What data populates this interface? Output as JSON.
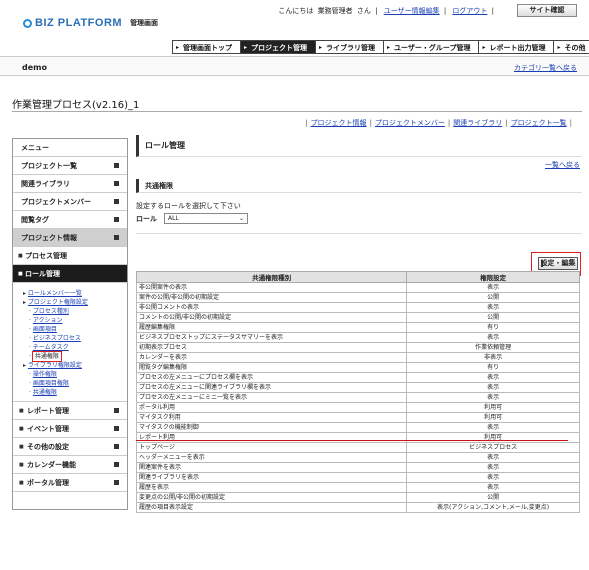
{
  "header": {
    "brand": "BIZ PLATFORM",
    "subtitle": "管理画面",
    "greeting_prefix": "こんにちは",
    "user_name": "業務管理者",
    "greeting_suffix": "さん",
    "user_info_link": "ユーザー情報編集",
    "logout_link": "ログアウト",
    "sitemap_button": "サイト確認"
  },
  "nav": {
    "tabs": [
      "管理画面トップ",
      "プロジェクト管理",
      "ライブラリ管理",
      "ユーザー・グループ管理",
      "レポート出力管理",
      "その他"
    ],
    "active_index": 1
  },
  "demobar": {
    "name": "demo",
    "category_link": "カテゴリ一覧へ戻る"
  },
  "page_title": "作業管理プロセス(v2.16)_1",
  "sublinks": [
    "プロジェクト情報",
    "プロジェクトメンバー",
    "関連ライブラリ",
    "プロジェクト一覧"
  ],
  "sidebar": {
    "menu_label": "メニュー",
    "items": [
      "プロジェクト一覧",
      "関連ライブラリ",
      "プロジェクトメンバー",
      "閲覧タグ",
      "プロジェクト情報"
    ],
    "process_mgmt": "プロセス管理",
    "role_mgmt": "ロール管理",
    "tree": {
      "role_member_list": "ロールメンバー一覧",
      "project_perm": "プロジェクト権限設定",
      "project_perm_children": [
        "プロセス種別",
        "アクション",
        "画面項目",
        "ビジネスプロセス",
        "チームタスク",
        "共通権限"
      ],
      "library_perm": "ライブラリ権限設定",
      "library_perm_children": [
        "操作権限",
        "画面項目権限",
        "共通権限"
      ]
    },
    "bottom_items": [
      "レポート管理",
      "イベント管理",
      "その他の設定",
      "カレンダー機能",
      "ポータル管理"
    ]
  },
  "content": {
    "section_title": "ロール管理",
    "back_link": "一覧へ戻る",
    "subsection_title": "共通権限",
    "instruction": "設定するロールを選択して下さい",
    "role_label": "ロール",
    "role_value": "ALL",
    "edit_button": "設定・編集",
    "table": {
      "headers": [
        "共通権限種別",
        "権限設定"
      ],
      "rows": [
        [
          "非公開案件の表示",
          "表示"
        ],
        [
          "案件の公開/非公開の初期設定",
          "公開"
        ],
        [
          "非公開コメントの表示",
          "表示"
        ],
        [
          "コメントの公開/非公開の初期設定",
          "公開"
        ],
        [
          "履歴編集権限",
          "有り"
        ],
        [
          "ビジネスプロセストップにステータスサマリーを表示",
          "表示"
        ],
        [
          "初期表示プロセス",
          "作業依頼管理"
        ],
        [
          "カレンダーを表示",
          "非表示"
        ],
        [
          "閲覧タグ編集権限",
          "有り"
        ],
        [
          "プロセスの左メニューにプロセス欄を表示",
          "表示"
        ],
        [
          "プロセスの左メニューに関連ライブラリ欄を表示",
          "表示"
        ],
        [
          "プロセスの左メニューにミニ一覧を表示",
          "表示"
        ],
        [
          "ポータル利用",
          "利用可"
        ],
        [
          "マイタスク利用",
          "利用可"
        ],
        [
          "マイタスクの機能制御",
          "表示"
        ],
        [
          "レポート利用",
          "利用可"
        ],
        [
          "トップページ",
          "ビジネスプロセス"
        ],
        [
          "ヘッダーメニューを表示",
          "表示"
        ],
        [
          "関連案件を表示",
          "表示"
        ],
        [
          "関連ライブラリを表示",
          "表示"
        ],
        [
          "履歴を表示",
          "表示"
        ],
        [
          "変更点の公開/非公開の初期設定",
          "公開"
        ],
        [
          "履歴の項目表示設定",
          "表示(アクション,コメント,メール,変更点)"
        ]
      ]
    }
  },
  "colors": {
    "accent_red": "#e02020",
    "link": "#1a3fb5",
    "brand": "#2a6fb8"
  }
}
